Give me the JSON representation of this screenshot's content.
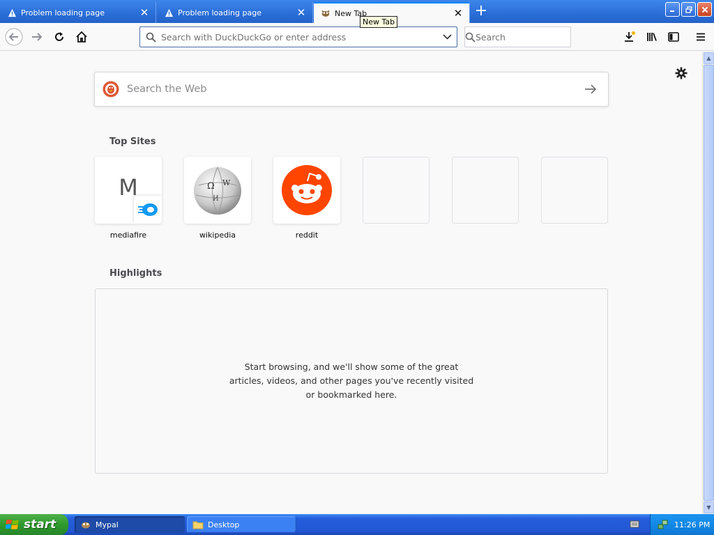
{
  "tabs": [
    {
      "title": "Problem loading page",
      "icon": "warning-icon"
    },
    {
      "title": "Problem loading page",
      "icon": "warning-icon"
    },
    {
      "title": "New Tab",
      "icon": "mypal-icon"
    }
  ],
  "tooltip": "New Tab",
  "navbar": {
    "url_placeholder": "Search with DuckDuckGo or enter address",
    "search_placeholder": "Search"
  },
  "newtab": {
    "web_search_placeholder": "Search the Web",
    "top_sites_title": "Top Sites",
    "top_sites": [
      {
        "label": "mediafire",
        "letter": "M"
      },
      {
        "label": "wikipedia"
      },
      {
        "label": "reddit"
      }
    ],
    "highlights_title": "Highlights",
    "highlights_empty": "Start browsing, and we'll show some of the great articles, videos, and other pages you've recently visited or bookmarked here."
  },
  "taskbar": {
    "start_label": "start",
    "items": [
      {
        "label": "Mypal",
        "active": true
      },
      {
        "label": "Desktop",
        "active": false
      }
    ],
    "clock": "11:26 PM"
  },
  "colors": {
    "xp_blue": "#245edb",
    "start_green": "#2f9a2c",
    "reddit": "#ff4500",
    "mediafire": "#1299f3",
    "ddg": "#de5833"
  }
}
